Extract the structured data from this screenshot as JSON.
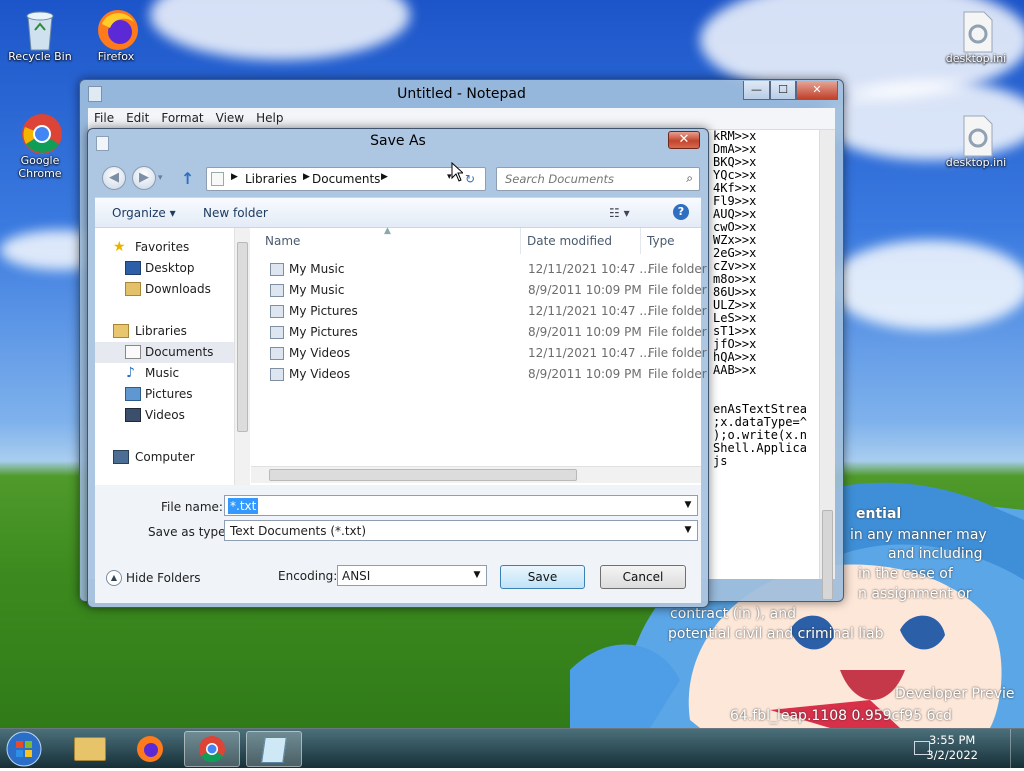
{
  "desktop": {
    "icons": [
      {
        "label": "Recycle Bin",
        "icon": "recycle-bin-icon"
      },
      {
        "label": "Firefox",
        "icon": "firefox-icon"
      },
      {
        "label": "Google Chrome",
        "icon": "chrome-icon"
      },
      {
        "label": "desktop.ini",
        "icon": "settings-file-icon"
      },
      {
        "label": "desktop.ini",
        "icon": "settings-file-icon"
      }
    ],
    "overlay_text": [
      "ential",
      "in any manner may",
      "and including",
      "in the case of",
      "n assignment or",
      "contract (in                                    ), and",
      "potential civil and criminal liab",
      "Developer Previe",
      "64.fbl_leap.1108              0.959cf95         6cd"
    ]
  },
  "notepad": {
    "title": "Untitled - Notepad",
    "menu": [
      "File",
      "Edit",
      "Format",
      "View",
      "Help"
    ],
    "text_lines": [
      "kRM>>x",
      "DmA>>x",
      "BKQ>>x",
      "YQc>>x",
      "4Kf>>x",
      "Fl9>>x",
      "AUQ>>x",
      "cwO>>x",
      "WZx>>x",
      "2eG>>x",
      "cZv>>x",
      "m8o>>x",
      "86U>>x",
      "ULZ>>x",
      "LeS>>x",
      "sT1>>x",
      "jfO>>x",
      "hQA>>x",
      "AAB>>x",
      "",
      "",
      "enAsTextStrea",
      ";x.dataType=^",
      ");o.write(x.n",
      "Shell.Applica",
      "js"
    ],
    "window_buttons": {
      "minimize": "—",
      "maximize": "☐",
      "close": "✕"
    }
  },
  "save_dialog": {
    "title": "Save As",
    "close_glyph": "✕",
    "back_glyph": "◀",
    "forward_glyph": "▶",
    "up_glyph": "↑",
    "breadcrumb": [
      "Libraries",
      "Documents"
    ],
    "search_placeholder": "Search Documents",
    "toolbar": {
      "organize": "Organize ▾",
      "new_folder": "New folder",
      "help": "?"
    },
    "nav": {
      "favorites": "Favorites",
      "desktop": "Desktop",
      "downloads": "Downloads",
      "libraries": "Libraries",
      "documents": "Documents",
      "music": "Music",
      "pictures": "Pictures",
      "videos": "Videos",
      "computer": "Computer"
    },
    "columns": [
      "Name",
      "Date modified",
      "Type"
    ],
    "rows": [
      {
        "name": "My Music",
        "date": "12/11/2021 10:47 ...",
        "type": "File folder"
      },
      {
        "name": "My Music",
        "date": "8/9/2011 10:09 PM",
        "type": "File folder"
      },
      {
        "name": "My Pictures",
        "date": "12/11/2021 10:47 ...",
        "type": "File folder"
      },
      {
        "name": "My Pictures",
        "date": "8/9/2011 10:09 PM",
        "type": "File folder"
      },
      {
        "name": "My Videos",
        "date": "12/11/2021 10:47 ...",
        "type": "File folder"
      },
      {
        "name": "My Videos",
        "date": "8/9/2011 10:09 PM",
        "type": "File folder"
      }
    ],
    "file_name_label": "File name:",
    "file_name_value": "*.txt",
    "save_type_label": "Save as type:",
    "save_type_value": "Text Documents (*.txt)",
    "encoding_label": "Encoding:",
    "encoding_value": "ANSI",
    "hide_folders": "Hide Folders",
    "save_button": "Save",
    "cancel_button": "Cancel"
  },
  "taskbar": {
    "time": "3:55 PM",
    "date": "3/2/2022"
  }
}
